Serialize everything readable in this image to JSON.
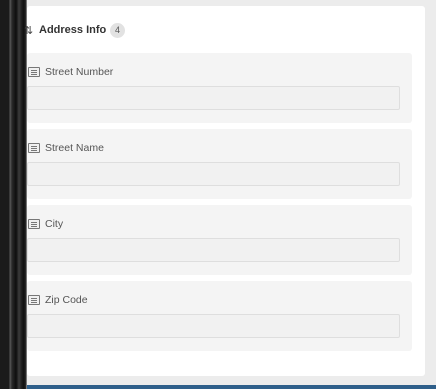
{
  "section": {
    "title": "Address Info",
    "count": "4",
    "icon": "sort-arrows-icon"
  },
  "fields": [
    {
      "label": "Street Number",
      "value": "",
      "icon": "form-field-icon"
    },
    {
      "label": "Street Name",
      "value": "",
      "icon": "form-field-icon"
    },
    {
      "label": "City",
      "value": "",
      "icon": "form-field-icon"
    },
    {
      "label": "Zip Code",
      "value": "",
      "icon": "form-field-icon"
    }
  ],
  "colors": {
    "card_background": "#ffffff",
    "field_group_background": "#f4f4f4",
    "input_background": "#f1f1f1",
    "bottom_accent": "#2f5f8a"
  }
}
